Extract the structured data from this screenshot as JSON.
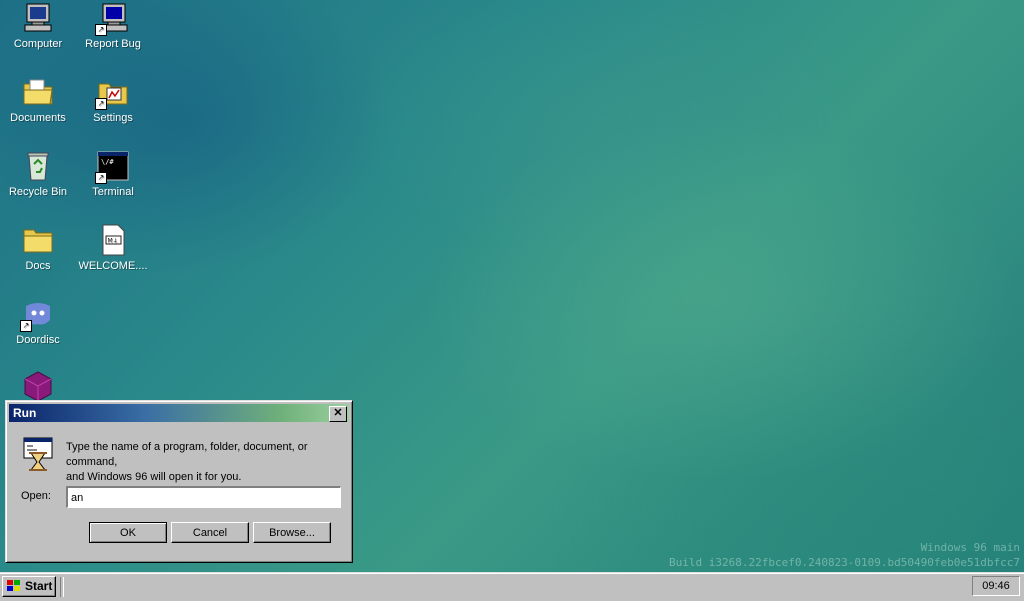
{
  "desktop": {
    "icons": [
      {
        "label": "Computer",
        "icon": "computer-icon"
      },
      {
        "label": "Report Bug",
        "icon": "report-bug-icon"
      },
      {
        "label": "Documents",
        "icon": "documents-folder-icon"
      },
      {
        "label": "Settings",
        "icon": "settings-folder-icon"
      },
      {
        "label": "Recycle Bin",
        "icon": "recycle-bin-icon"
      },
      {
        "label": "Terminal",
        "icon": "terminal-icon"
      },
      {
        "label": "Docs",
        "icon": "folder-icon"
      },
      {
        "label": "WELCOME....",
        "icon": "markdown-file-icon"
      },
      {
        "label": "Doordisc",
        "icon": "doordisc-icon"
      },
      {
        "label": "",
        "icon": "cube-icon"
      }
    ]
  },
  "run_dialog": {
    "title": "Run",
    "close_glyph": "✕",
    "prompt_line1": "Type the name of a program, folder, document, or command,",
    "prompt_line2": "and Windows 96 will open it for you.",
    "open_label": "Open:",
    "open_value": "an",
    "ok_label": "OK",
    "cancel_label": "Cancel",
    "browse_label": "Browse..."
  },
  "taskbar": {
    "start_label": "Start",
    "clock": "09:46"
  },
  "watermark": {
    "line1": "Windows 96 main",
    "line2": "Build i3268.22fbcef0.240823-0109.bd50490feb0e51dbfcc7"
  },
  "colors": {
    "desktop_teal": "#2a8a8a",
    "chrome_gray": "#c0c0c0",
    "title_start": "#0a246a",
    "title_end": "#9ad0a0"
  }
}
